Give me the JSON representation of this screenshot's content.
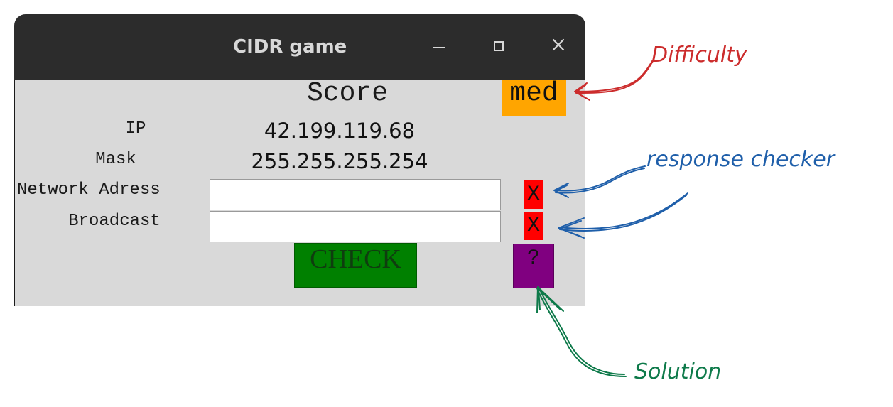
{
  "window": {
    "title": "CIDR game"
  },
  "game": {
    "score_label": "Score",
    "difficulty": "med",
    "ip_label": "IP",
    "ip_value": "42.199.119.68",
    "mask_label": "Mask",
    "mask_value": "255.255.255.254",
    "network_label": "Network Adress",
    "network_value": "",
    "broadcast_label": "Broadcast",
    "broadcast_value": "",
    "network_checker": "X",
    "broadcast_checker": "X",
    "check_button": "CHECK",
    "solution_button": "?"
  },
  "annotations": {
    "difficulty": "Difficulty",
    "response_checker": "response checker",
    "solution": "Solution"
  },
  "colors": {
    "difficulty_bg": "#ffa500",
    "checker_bg": "#ff0000",
    "check_button_bg": "#008000",
    "solution_button_bg": "#800080",
    "annotation_red": "#cc2c2c",
    "annotation_blue": "#1f5faa",
    "annotation_green": "#0e7a4a"
  },
  "icons": {
    "minimize": "minimize-icon",
    "maximize": "maximize-icon",
    "close": "close-icon"
  }
}
